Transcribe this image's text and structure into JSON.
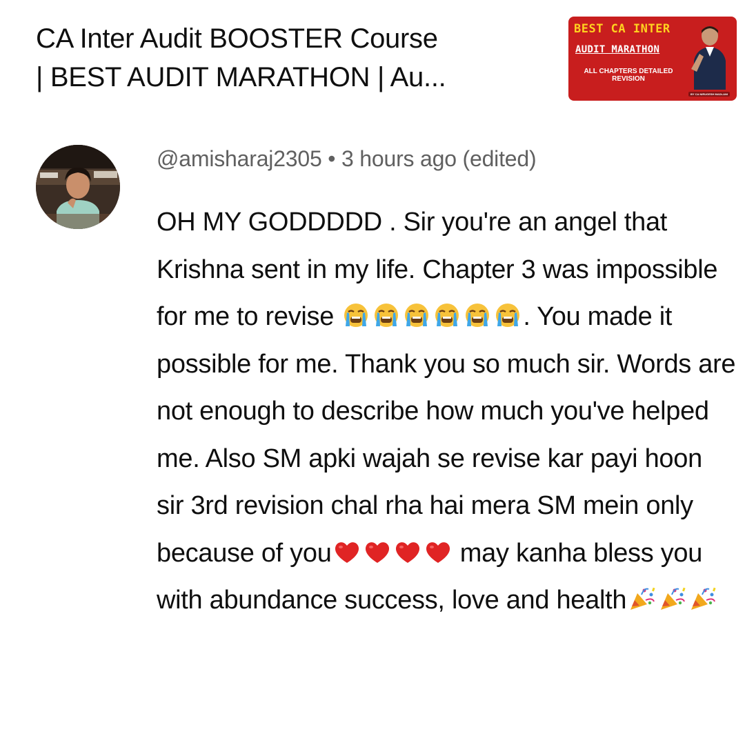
{
  "video": {
    "title_line1": "CA Inter Audit BOOSTER Course",
    "title_line2": "| BEST AUDIT MARATHON | Au...",
    "thumbnail": {
      "line1": "BEST CA INTER",
      "line2": "AUDIT MARATHON",
      "line3": "ALL CHAPTERS DETAILED REVISION",
      "credit": "BY CA NIRUGESH MADLANI",
      "bg_color": "#c81e1e",
      "accent_color": "#ffd21f"
    }
  },
  "comment": {
    "author": "@amisharaj2305",
    "separator": "•",
    "time": "3 hours ago (edited)",
    "segments": [
      "OH MY GODDDDD . Sir you're an angel that Krishna sent in my life. Chapter 3 was impossible for me to revise ",
      ". You made it possible for me. Thank you so much sir. Words are not enough to describe how much you've helped me. Also SM apki wajah se revise kar payi hoon sir 3rd revision chal rha hai mera SM mein only because of you",
      " may kanha bless you with abundance success, love and health"
    ],
    "emojis": {
      "crying": "loudly-crying-face-icon",
      "heart": "red-heart-icon",
      "party": "party-popper-icon"
    }
  }
}
